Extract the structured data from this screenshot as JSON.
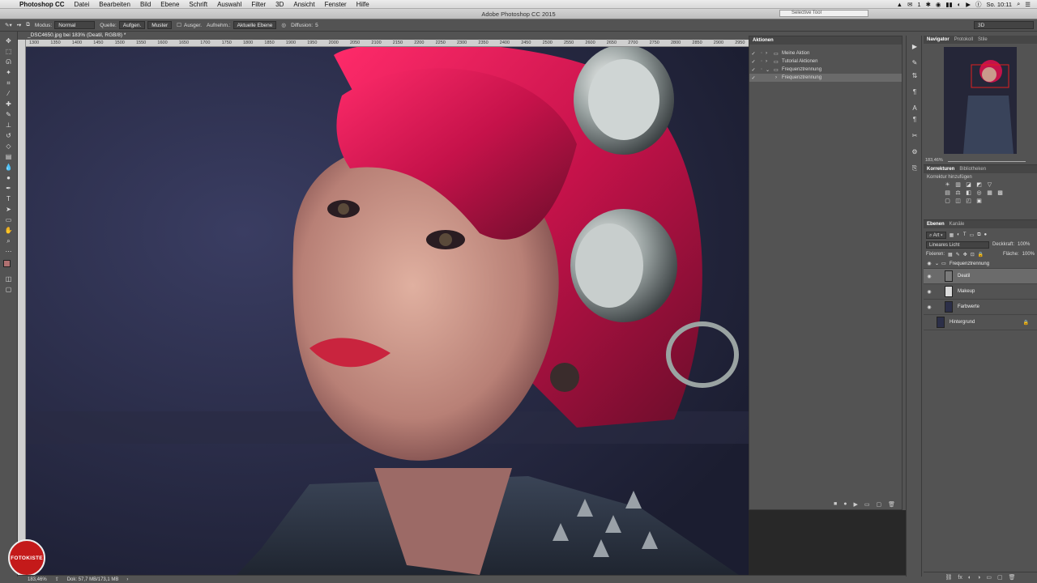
{
  "menubar": {
    "app": "Photoshop CC",
    "items": [
      "Datei",
      "Bearbeiten",
      "Bild",
      "Ebene",
      "Schrift",
      "Auswahl",
      "Filter",
      "3D",
      "Ansicht",
      "Fenster",
      "Hilfe"
    ],
    "status_icons": [
      "▲",
      "✉",
      "1",
      "✱",
      "◉",
      "▮▮",
      "◐",
      "▶",
      "Ⓘ"
    ],
    "clock": "So. 10:11"
  },
  "window": {
    "title": "Adobe Photoshop CC 2015",
    "floating_window": "Selective Tool"
  },
  "options": {
    "mode_label": "Modus:",
    "mode_value": "Normal",
    "source_label": "Quelle:",
    "source_btn1": "Aufgen.",
    "source_btn2": "Muster",
    "aligned_label": "Ausger.",
    "sample_label": "Aufnehm.:",
    "sample_value": "Aktuelle Ebene",
    "diffusion_label": "Diffusion:",
    "diffusion_value": "5",
    "workspace": "3D"
  },
  "document": {
    "tab": "_DSC4650.jpg bei 183% (Deatil, RGB/8) *",
    "ruler_ticks": [
      "1300",
      "1350",
      "1400",
      "1450",
      "1500",
      "1550",
      "1600",
      "1650",
      "1700",
      "1750",
      "1800",
      "1850",
      "1900",
      "1950",
      "2000",
      "2050",
      "2100",
      "2150",
      "2200",
      "2250",
      "2300",
      "2350",
      "2400",
      "2450",
      "2500",
      "2550",
      "2600",
      "2650",
      "2700",
      "2750",
      "2800",
      "2850",
      "2900",
      "2950"
    ]
  },
  "status": {
    "zoom": "183,46%",
    "doc": "Dok: 57,7 MB/173,1 MB"
  },
  "logo": {
    "text": "FOTOKISTE"
  },
  "actions": {
    "title": "Aktionen",
    "rows": [
      {
        "label": "Meine Aktion",
        "checked": true,
        "level": 0
      },
      {
        "label": "Tutorial Aktionen",
        "checked": true,
        "level": 0
      },
      {
        "label": "Frequenztrennung",
        "checked": true,
        "level": 0
      },
      {
        "label": "Frequenztrennung",
        "checked": true,
        "level": 1,
        "selected": true
      }
    ],
    "footer": [
      "■",
      "●",
      "▶",
      "▭",
      "▢",
      "🗑"
    ]
  },
  "navigator": {
    "tabs": [
      "Navigator",
      "Protokoll",
      "Stile"
    ],
    "zoom": "183,46%"
  },
  "korrekturen": {
    "tabs": [
      "Korrekturen",
      "Bibliotheken"
    ],
    "hint": "Korrektur hinzufügen",
    "icons": [
      "☀",
      "▥",
      "◪",
      "◩",
      "▽",
      "",
      "▤",
      "⚖",
      "◧",
      "◎",
      "▦",
      "▩",
      "▢",
      "◫",
      "◰",
      "▣",
      "",
      ""
    ]
  },
  "layers": {
    "tabs": [
      "Ebenen",
      "Kanäle"
    ],
    "filter": "Art",
    "blend": "Lineares Licht",
    "opacity_label": "Deckkraft:",
    "opacity": "100%",
    "lock_label": "Fixieren:",
    "fill_label": "Fläche:",
    "fill": "100%",
    "group": "Frequenztrennung",
    "items": [
      {
        "name": "Deatil",
        "selected": true
      },
      {
        "name": "Makeup"
      },
      {
        "name": "Farbwerte"
      },
      {
        "name": "Hintergrund",
        "locked": true
      }
    ],
    "footer": [
      "⛓",
      "fx",
      "◐",
      "◑",
      "▭",
      "▢",
      "🗑"
    ]
  }
}
